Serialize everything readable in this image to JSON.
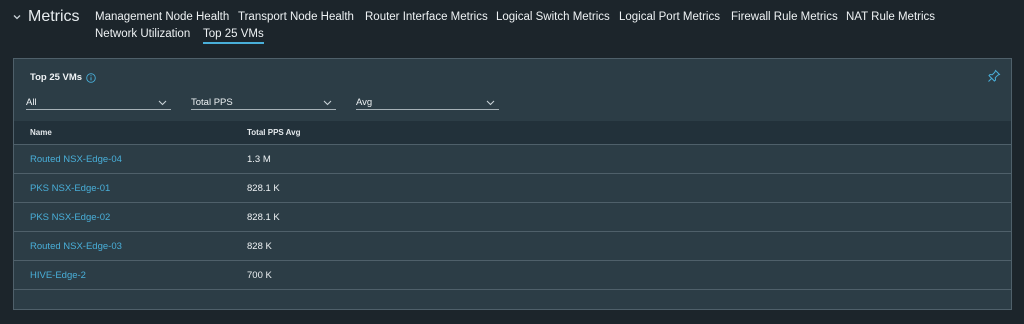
{
  "header": {
    "title": "Metrics",
    "tabs": [
      {
        "label": "Management Node Health"
      },
      {
        "label": "Transport Node Health"
      },
      {
        "label": "Router Interface Metrics"
      },
      {
        "label": "Logical Switch Metrics"
      },
      {
        "label": "Logical Port Metrics"
      },
      {
        "label": "Firewall Rule Metrics"
      },
      {
        "label": "NAT Rule Metrics"
      },
      {
        "label": "Network Utilization"
      },
      {
        "label": "Top 25 VMs"
      }
    ],
    "active_tab": "Top 25 VMs"
  },
  "card": {
    "title": "Top 25 VMs",
    "filters": {
      "scope": "All",
      "metric": "Total PPS",
      "aggregation": "Avg"
    },
    "table": {
      "columns": [
        "Name",
        "Total PPS Avg"
      ],
      "rows": [
        {
          "name": "Routed NSX-Edge-04",
          "value": "1.3 M"
        },
        {
          "name": "PKS NSX-Edge-01",
          "value": "828.1 K"
        },
        {
          "name": "PKS NSX-Edge-02",
          "value": "828.1 K"
        },
        {
          "name": "Routed NSX-Edge-03",
          "value": "828 K"
        },
        {
          "name": "HIVE-Edge-2",
          "value": "700 K"
        }
      ]
    }
  },
  "colors": {
    "accent": "#49afd9",
    "background": "#1c252b",
    "card": "#2c3d46"
  },
  "icons": [
    "chevron-down-icon",
    "info-icon",
    "pin-icon",
    "caret-down-icon"
  ]
}
